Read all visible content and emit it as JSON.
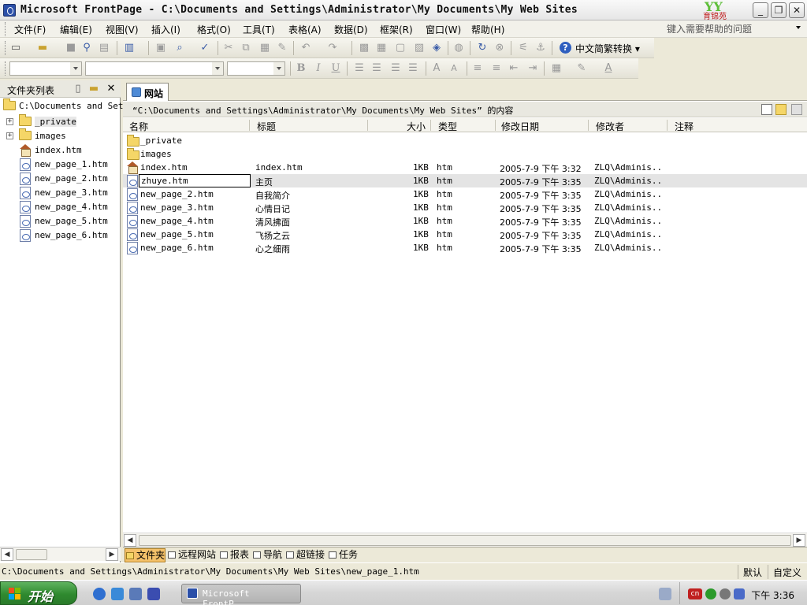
{
  "window": {
    "title": "Microsoft FrontPage - C:\\Documents and Settings\\Administrator\\My Documents\\My Web Sites",
    "logo_text": "育锦苑",
    "min_label": "_",
    "restore_label": "❐",
    "close_label": "✕"
  },
  "menu": {
    "items": [
      "文件(F)",
      "编辑(E)",
      "视图(V)",
      "插入(I)",
      "格式(O)",
      "工具(T)",
      "表格(A)",
      "数据(D)",
      "框架(R)",
      "窗口(W)",
      "帮助(H)"
    ],
    "help_placeholder": "键入需要帮助的问题"
  },
  "toolbar": {
    "converter_label": "中文简繁转换",
    "help_icon": "?"
  },
  "format_toolbar": {
    "bold": "B",
    "italic": "I",
    "underline": "U"
  },
  "folder_pane": {
    "title": "文件夹列表",
    "root": "C:\\Documents and Sett",
    "items": [
      {
        "name": "_private",
        "type": "folder",
        "expandable": true
      },
      {
        "name": "images",
        "type": "folder",
        "expandable": true
      },
      {
        "name": "index.htm",
        "type": "home"
      },
      {
        "name": "new_page_1.htm",
        "type": "page"
      },
      {
        "name": "new_page_2.htm",
        "type": "page"
      },
      {
        "name": "new_page_3.htm",
        "type": "page"
      },
      {
        "name": "new_page_4.htm",
        "type": "page"
      },
      {
        "name": "new_page_5.htm",
        "type": "page"
      },
      {
        "name": "new_page_6.htm",
        "type": "page"
      }
    ]
  },
  "main": {
    "tab_label": "网站",
    "path_text": "“C:\\Documents and Settings\\Administrator\\My Documents\\My Web Sites” 的内容",
    "columns": [
      "名称",
      "标题",
      "大小",
      "类型",
      "修改日期",
      "修改者",
      "注释"
    ],
    "rows": [
      {
        "name": "_private",
        "icon": "folder",
        "title": "",
        "size": "",
        "type": "",
        "date": "",
        "modifier": "",
        "note": ""
      },
      {
        "name": "images",
        "icon": "folder",
        "title": "",
        "size": "",
        "type": "",
        "date": "",
        "modifier": "",
        "note": ""
      },
      {
        "name": "index.htm",
        "icon": "home",
        "title": "index.htm",
        "size": "1KB",
        "type": "htm",
        "date": "2005-7-9 下午 3:32",
        "modifier": "ZLQ\\Adminis..",
        "note": ""
      },
      {
        "name": "zhuye.htm",
        "icon": "page",
        "title": "主页",
        "size": "1KB",
        "type": "htm",
        "date": "2005-7-9 下午 3:35",
        "modifier": "ZLQ\\Adminis..",
        "note": "",
        "editing": true
      },
      {
        "name": "new_page_2.htm",
        "icon": "page",
        "title": "自我简介",
        "size": "1KB",
        "type": "htm",
        "date": "2005-7-9 下午 3:35",
        "modifier": "ZLQ\\Adminis..",
        "note": ""
      },
      {
        "name": "new_page_3.htm",
        "icon": "page",
        "title": "心情日记",
        "size": "1KB",
        "type": "htm",
        "date": "2005-7-9 下午 3:35",
        "modifier": "ZLQ\\Adminis..",
        "note": ""
      },
      {
        "name": "new_page_4.htm",
        "icon": "page",
        "title": "清风拂面",
        "size": "1KB",
        "type": "htm",
        "date": "2005-7-9 下午 3:35",
        "modifier": "ZLQ\\Adminis..",
        "note": ""
      },
      {
        "name": "new_page_5.htm",
        "icon": "page",
        "title": "飞扬之云",
        "size": "1KB",
        "type": "htm",
        "date": "2005-7-9 下午 3:35",
        "modifier": "ZLQ\\Adminis..",
        "note": ""
      },
      {
        "name": "new_page_6.htm",
        "icon": "page",
        "title": "心之细雨",
        "size": "1KB",
        "type": "htm",
        "date": "2005-7-9 下午 3:35",
        "modifier": "ZLQ\\Adminis..",
        "note": ""
      }
    ],
    "view_buttons": [
      "文件夹",
      "远程网站",
      "报表",
      "导航",
      "超链接",
      "任务"
    ]
  },
  "statusbar": {
    "path": "C:\\Documents and Settings\\Administrator\\My Documents\\My Web Sites\\new_page_1.htm",
    "mode": "默认",
    "custom": "自定义"
  },
  "taskbar": {
    "start_label": "开始",
    "task_label": "Microsoft FrontP...",
    "ime_label": "cn",
    "clock": "下午 3:36"
  }
}
